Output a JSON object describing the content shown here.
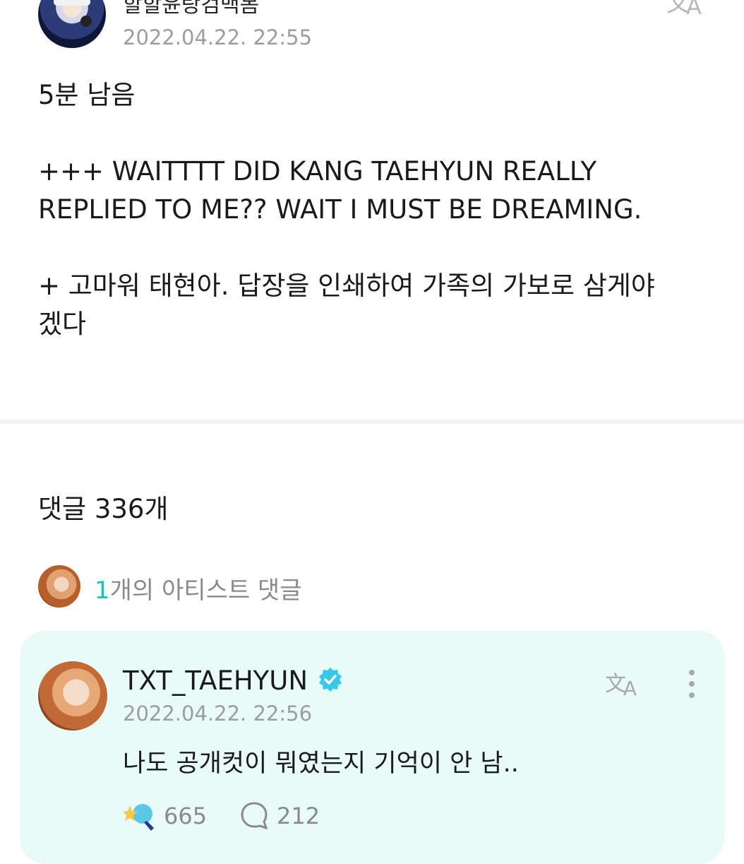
{
  "post": {
    "author_name": "할할윤랑검백봄",
    "date": "2022.04.22. 22:55",
    "body": "5분 남음\n\n+++ WAITTTT DID KANG TAEHYUN REALLY\nREPLIED TO ME?? WAIT I MUST BE DREAMING.\n\n+ 고마워 태현아. 답장을 인쇄하여 가족의 가보로 삼게야\n겠다",
    "translate_icon": "translate-icon"
  },
  "comments": {
    "count_label": "댓글 336개",
    "artist_summary": {
      "count": "1",
      "label": "개의 아티스트 댓글"
    },
    "artist_comment": {
      "name": "TXT_TAEHYUN",
      "verified_icon": "verified-badge-icon",
      "date": "2022.04.22. 22:56",
      "text": "나도 공개컷이 뭐였는지 기억이 안 남..",
      "likes": "665",
      "replies": "212",
      "accent_color": "#13c8b4",
      "card_color": "#e8fbf8"
    }
  }
}
